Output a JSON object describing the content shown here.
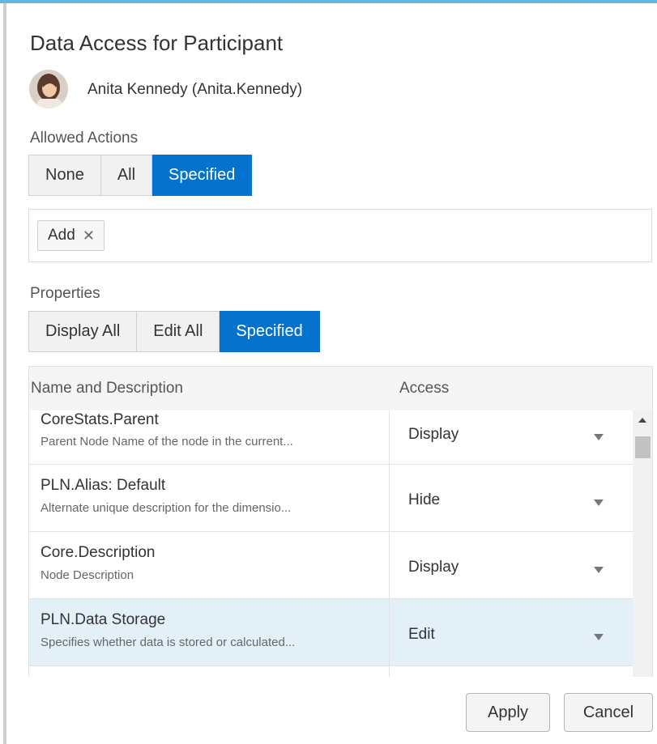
{
  "dialog": {
    "title": "Data Access for Participant",
    "participant": "Anita Kennedy (Anita.Kennedy)"
  },
  "allowed_actions": {
    "label": "Allowed Actions",
    "options": [
      "None",
      "All",
      "Specified"
    ],
    "selected": "Specified",
    "chips": [
      {
        "label": "Add",
        "remove_icon": "close-icon"
      }
    ]
  },
  "properties": {
    "label": "Properties",
    "options": [
      "Display All",
      "Edit All",
      "Specified"
    ],
    "selected": "Specified",
    "columns": [
      "Name and Description",
      "Access"
    ],
    "rows": [
      {
        "name": "CoreStats.Parent",
        "description": "Parent Node Name of the node in the current...",
        "access": "Display",
        "selected": false
      },
      {
        "name": "PLN.Alias: Default",
        "description": "Alternate unique description for the dimensio...",
        "access": "Hide",
        "selected": false
      },
      {
        "name": "Core.Description",
        "description": "Node Description",
        "access": "Display",
        "selected": false
      },
      {
        "name": "PLN.Data Storage",
        "description": "Specifies whether data is stored or calculated...",
        "access": "Edit",
        "selected": true
      }
    ]
  },
  "footer": {
    "apply": "Apply",
    "cancel": "Cancel"
  },
  "colors": {
    "accent": "#0572ce",
    "top_border": "#5fb8e0",
    "selected_row": "#e4f0f8"
  }
}
